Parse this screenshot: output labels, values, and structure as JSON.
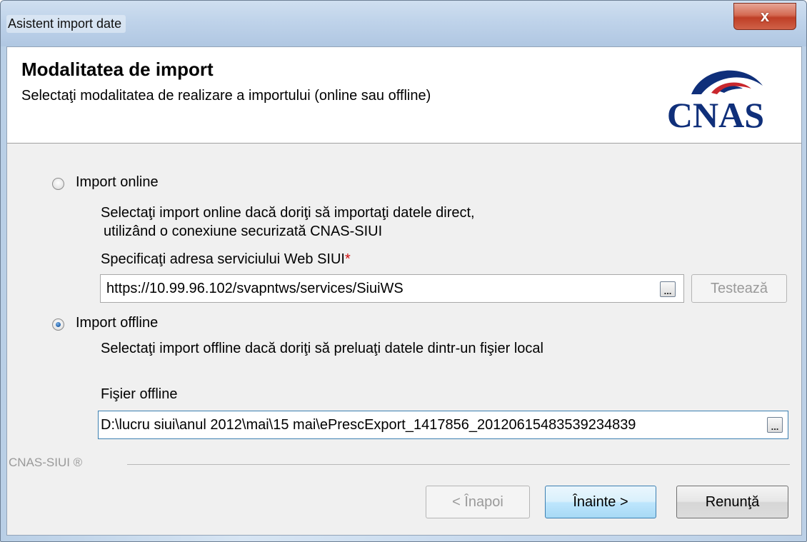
{
  "window": {
    "title": "Asistent import date",
    "close_glyph": "x",
    "accent_color": "#b9cfe6"
  },
  "header": {
    "title": "Modalitatea de import",
    "subtitle": "Selectaţi modalitatea de realizare a importului (online sau offline)",
    "logo_text": "CNAS",
    "logo_color": "#0f2f7a",
    "logo_accent": "#c9272d"
  },
  "online": {
    "label": "Import online",
    "selected": false,
    "description_line1": "Selectaţi import online dacă doriţi să importaţi datele direct,",
    "description_line2": "utilizând o conexiune securizată CNAS-SIUI",
    "address_label": "Specificaţi adresa serviciului Web SIUI",
    "required_mark": "*",
    "address_value": "https://10.99.96.102/svapntws/services/SiuiWS",
    "browse_label": "...",
    "test_button": "Testează"
  },
  "offline": {
    "label": "Import offline",
    "selected": true,
    "description": "Selectaţi import offline dacă doriţi să preluaţi datele dintr-un fişier local",
    "file_label": "Fişier offline",
    "file_value": "D:\\lucru siui\\anul 2012\\mai\\15 mai\\ePrescExport_1417856_20120615483539234839",
    "browse_label": "..."
  },
  "footer": {
    "brand": "CNAS-SIUI ®",
    "back_button": "< Înapoi",
    "next_button": "Înainte >",
    "cancel_button": "Renunţă"
  }
}
